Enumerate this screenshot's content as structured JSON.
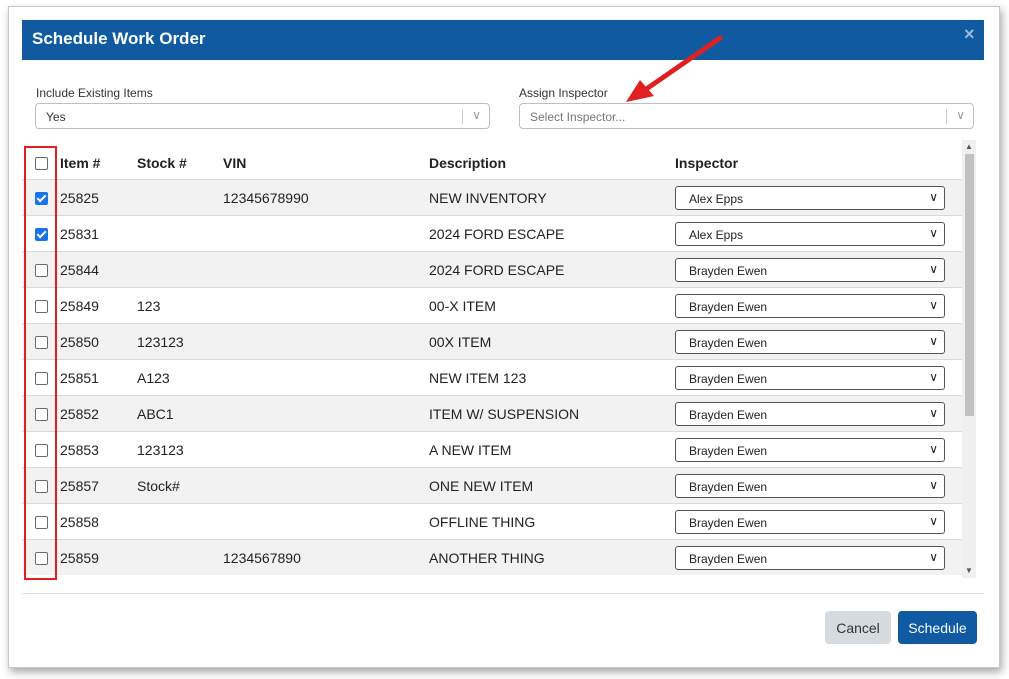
{
  "dialog": {
    "title": "Schedule Work Order",
    "close_glyph": "×"
  },
  "fields": {
    "include_existing": {
      "label": "Include Existing Items",
      "value": "Yes"
    },
    "assign_inspector": {
      "label": "Assign Inspector",
      "placeholder": "Select Inspector..."
    }
  },
  "table": {
    "headers": [
      "Item #",
      "Stock #",
      "VIN",
      "Description",
      "Inspector"
    ],
    "rows": [
      {
        "checked": true,
        "item": "25825",
        "stock": "",
        "vin": "12345678990",
        "description": "NEW INVENTORY",
        "inspector": "Alex Epps"
      },
      {
        "checked": true,
        "item": "25831",
        "stock": "",
        "vin": "",
        "description": "2024 FORD ESCAPE",
        "inspector": "Alex Epps"
      },
      {
        "checked": false,
        "item": "25844",
        "stock": "",
        "vin": "",
        "description": "2024 FORD ESCAPE",
        "inspector": "Brayden Ewen"
      },
      {
        "checked": false,
        "item": "25849",
        "stock": "123",
        "vin": "",
        "description": "00-X ITEM",
        "inspector": "Brayden Ewen"
      },
      {
        "checked": false,
        "item": "25850",
        "stock": "123123",
        "vin": "",
        "description": "00X ITEM",
        "inspector": "Brayden Ewen"
      },
      {
        "checked": false,
        "item": "25851",
        "stock": "A123",
        "vin": "",
        "description": "NEW ITEM 123",
        "inspector": "Brayden Ewen"
      },
      {
        "checked": false,
        "item": "25852",
        "stock": "ABC1",
        "vin": "",
        "description": "ITEM W/ SUSPENSION",
        "inspector": "Brayden Ewen"
      },
      {
        "checked": false,
        "item": "25853",
        "stock": "123123",
        "vin": "",
        "description": "A NEW ITEM",
        "inspector": "Brayden Ewen"
      },
      {
        "checked": false,
        "item": "25857",
        "stock": "Stock#",
        "vin": "",
        "description": "ONE NEW ITEM",
        "inspector": "Brayden Ewen"
      },
      {
        "checked": false,
        "item": "25858",
        "stock": "",
        "vin": "",
        "description": "OFFLINE THING",
        "inspector": "Brayden Ewen"
      },
      {
        "checked": false,
        "item": "25859",
        "stock": "",
        "vin": "1234567890",
        "description": "ANOTHER THING",
        "inspector": "Brayden Ewen"
      }
    ]
  },
  "buttons": {
    "cancel": "Cancel",
    "schedule": "Schedule"
  },
  "colors": {
    "header_bg": "#0f5aa0",
    "annotation_red": "#e02020",
    "checkbox_on": "#1a73e8"
  },
  "icons": {
    "dropdown": "chevron-down-icon",
    "close": "close-icon",
    "arrow": "red-arrow-annotation"
  }
}
